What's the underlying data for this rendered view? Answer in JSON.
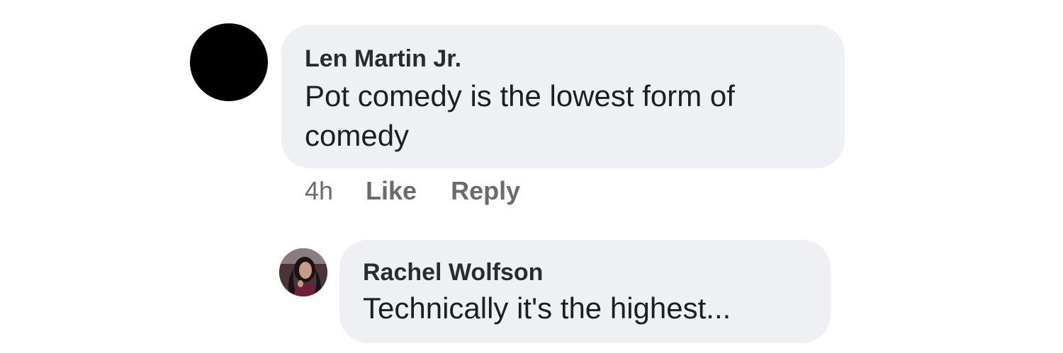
{
  "comments": [
    {
      "author": "Len Martin Jr.",
      "text": "Pot comedy is the lowest form of comedy",
      "time": "4h",
      "like_label": "Like",
      "reply_label": "Reply"
    }
  ],
  "reply": {
    "author": "Rachel Wolfson",
    "text": "Technically it's the highest..."
  },
  "colors": {
    "bubble": "#eff0f3",
    "meta_text": "#686b70",
    "avatar_placeholder": "#000000"
  }
}
